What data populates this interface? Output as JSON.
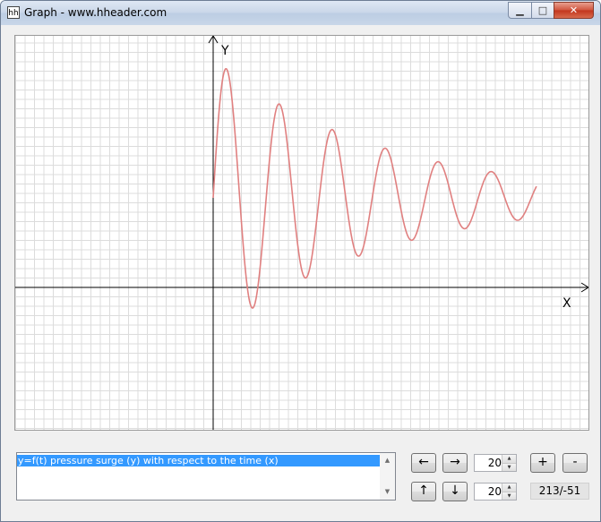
{
  "window": {
    "title": "Graph - www.hheader.com",
    "app_icon": "hh",
    "minimize_glyph": "▁",
    "maximize_glyph": "□",
    "close_glyph": "✕"
  },
  "graph": {
    "x_axis_label": "X",
    "y_axis_label": "Y",
    "curve_color": "#e08080",
    "grid_color": "#dcdcdc",
    "axis_color": "#000000"
  },
  "function_list": {
    "items": [
      "y=f(t) pressure surge (y) with respect to the time (x)"
    ],
    "selected_index": 0
  },
  "controls": {
    "left_label": "←",
    "right_label": "→",
    "up_label": "↑",
    "down_label": "↓",
    "zoom_in_label": "+",
    "zoom_out_label": "-",
    "x_step_value": "20",
    "y_step_value": "20",
    "cursor_coordinates": "213/-51"
  }
}
